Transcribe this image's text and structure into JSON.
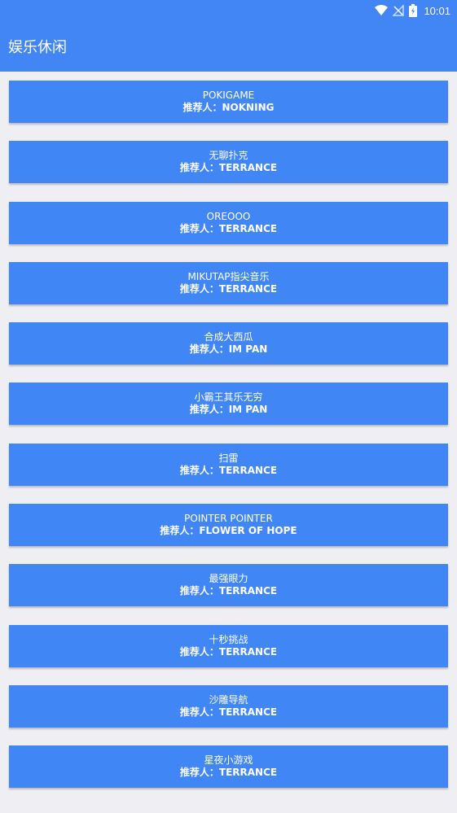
{
  "status_bar": {
    "time": "10:01",
    "icons": [
      "wifi-icon",
      "no-signal-icon",
      "battery-charging-icon"
    ]
  },
  "header": {
    "title": "娱乐休闲"
  },
  "recommender_prefix": "推荐人：",
  "items": [
    {
      "name": "POKIGAME",
      "recommender": "推荐人：NOKNING"
    },
    {
      "name": "无聊扑克",
      "recommender": "推荐人：TERRANCE"
    },
    {
      "name": "OREOOO",
      "recommender": "推荐人：TERRANCE"
    },
    {
      "name": "MIKUTAP指尖音乐",
      "recommender": "推荐人：TERRANCE"
    },
    {
      "name": "合成大西瓜",
      "recommender": "推荐人：IM PAN"
    },
    {
      "name": "小霸王其乐无穷",
      "recommender": "推荐人：IM PAN"
    },
    {
      "name": "扫雷",
      "recommender": "推荐人：TERRANCE"
    },
    {
      "name": "POINTER POINTER",
      "recommender": "推荐人：FLOWER OF HOPE"
    },
    {
      "name": "最强眼力",
      "recommender": "推荐人：TERRANCE"
    },
    {
      "name": "十秒挑战",
      "recommender": "推荐人：TERRANCE"
    },
    {
      "name": "沙雕导航",
      "recommender": "推荐人：TERRANCE"
    },
    {
      "name": "星夜小游戏",
      "recommender": "推荐人：TERRANCE"
    }
  ],
  "colors": {
    "app_bar": "#4285f4",
    "card": "#4186f5",
    "background": "#eeeef3",
    "text": "#ffffff"
  }
}
